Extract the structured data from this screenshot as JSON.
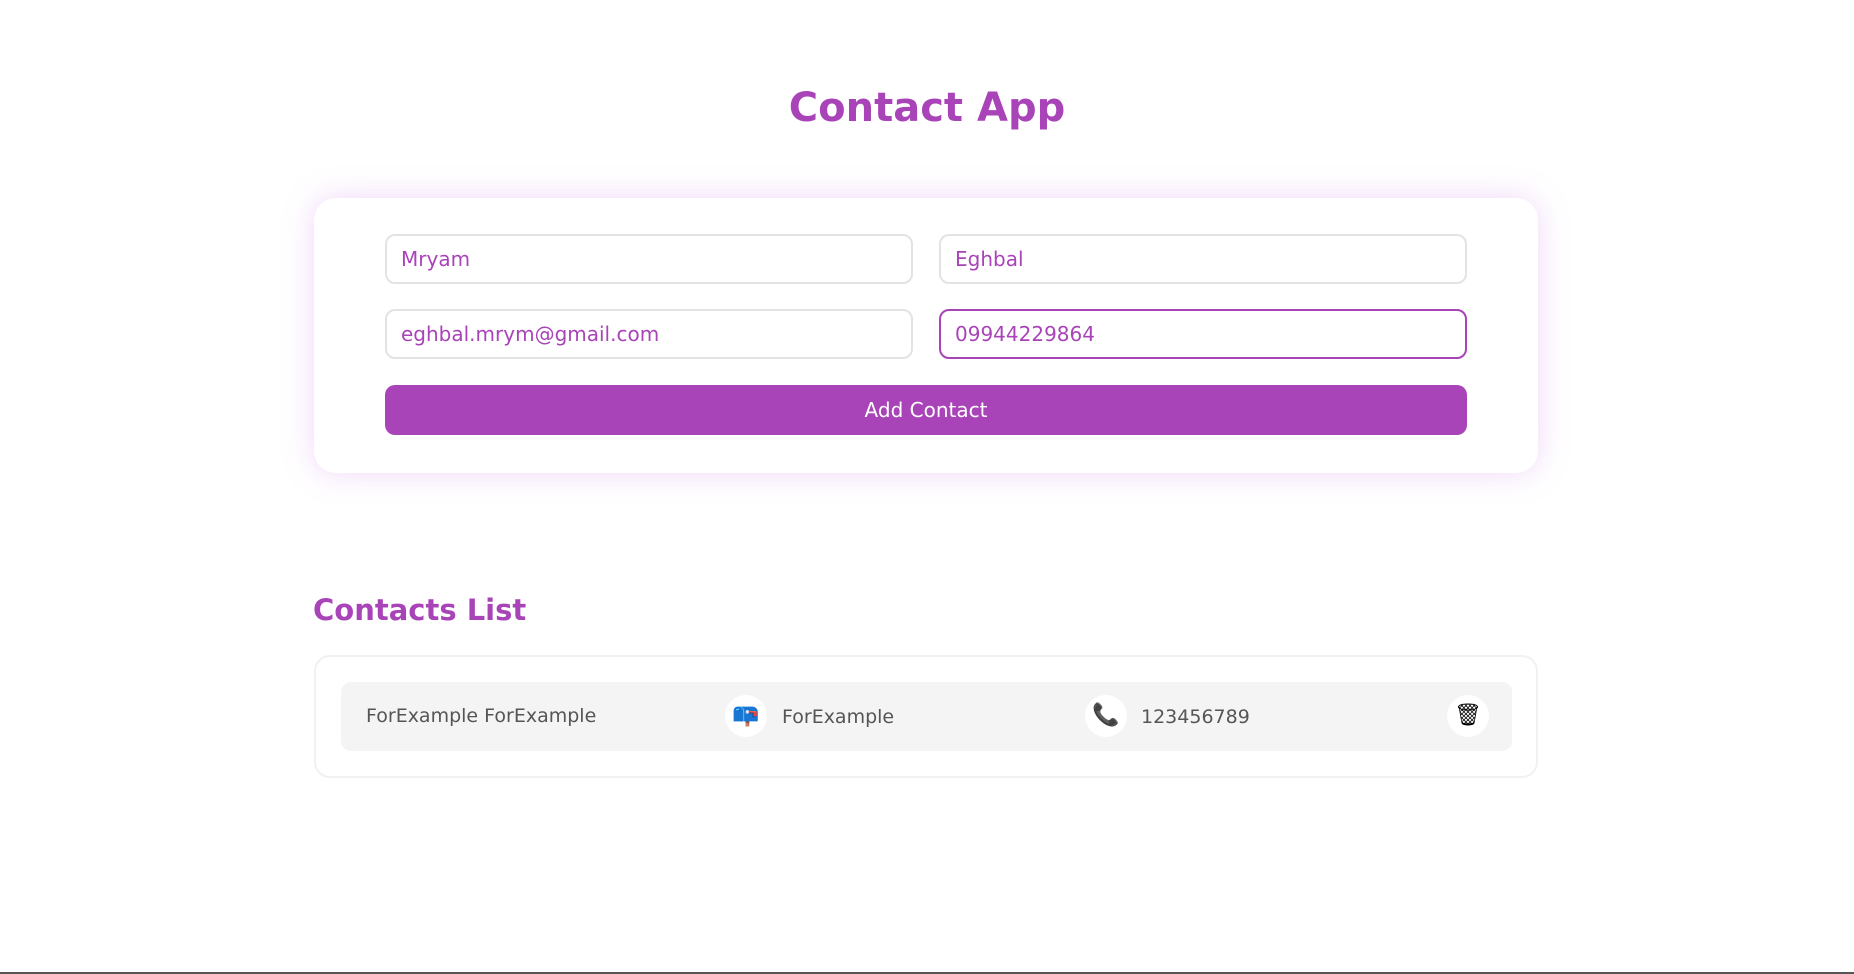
{
  "app": {
    "title": "Contact App"
  },
  "form": {
    "first_name": "Mryam",
    "last_name": "Eghbal",
    "email": "eghbal.mrym@gmail.com",
    "phone": "09944229864",
    "submit_label": "Add Contact"
  },
  "contacts_list": {
    "title": "Contacts List",
    "items": [
      {
        "name": "ForExample ForExample",
        "email_icon": "mailbox-icon",
        "email": "ForExample",
        "phone_icon": "telephone-icon",
        "phone": "123456789",
        "delete_icon": "trash-icon"
      }
    ]
  },
  "colors": {
    "accent": "#a944b8",
    "text_muted": "#555555",
    "row_bg": "#f4f4f4",
    "border": "#e3e3e3"
  }
}
